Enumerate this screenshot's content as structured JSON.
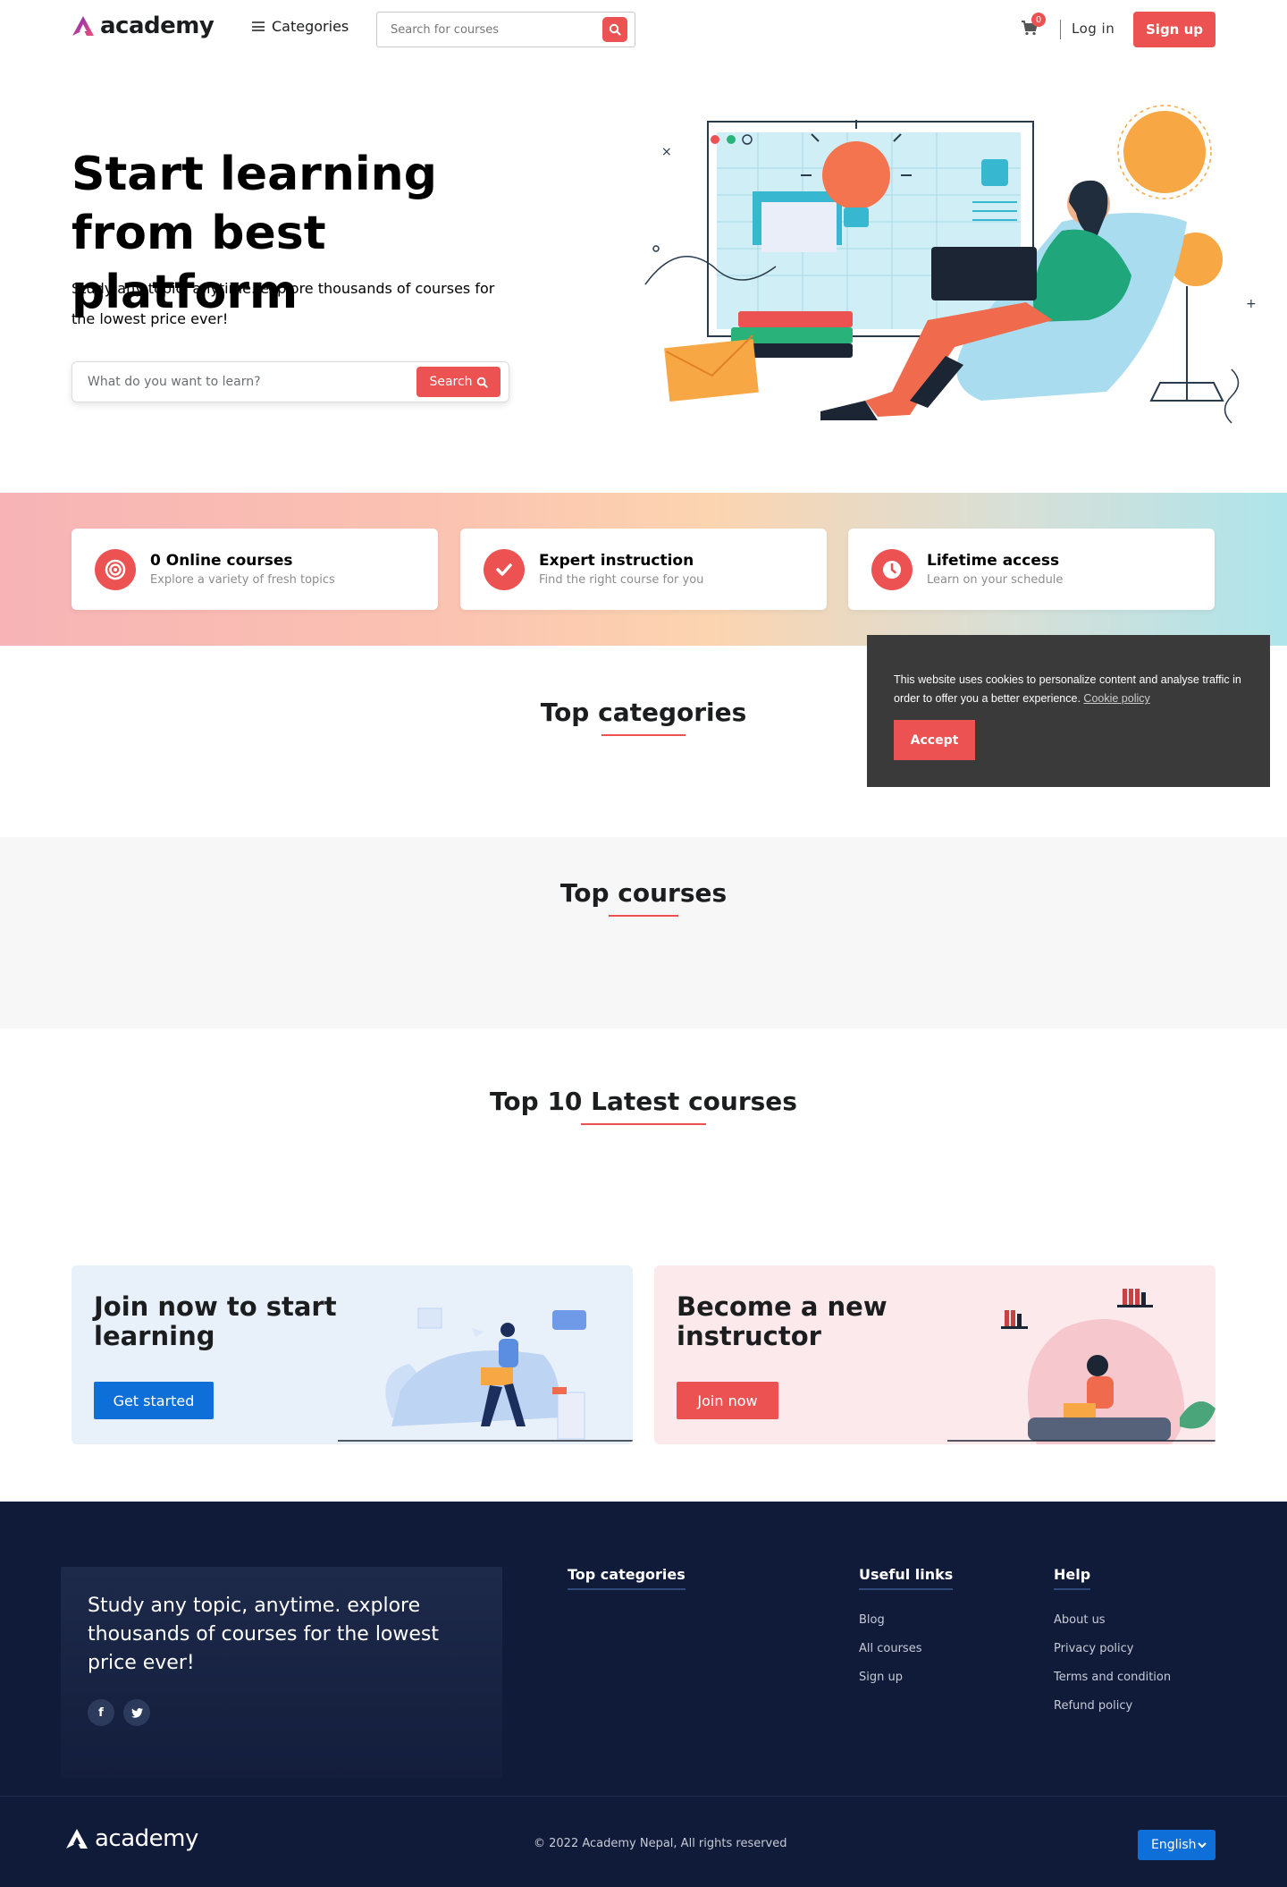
{
  "header": {
    "logo_text": "academy",
    "categories_label": "Categories",
    "search_placeholder": "Search for courses",
    "cart_count": "0",
    "login_label": "Log in",
    "signup_label": "Sign up",
    "accent_color": "#ec5252"
  },
  "hero": {
    "title": "Start learning from best platform",
    "subtitle": "Study any topic, anytime. explore thousands of courses for the lowest price ever!",
    "search_placeholder": "What do you want to learn?",
    "search_button": "Search"
  },
  "features": [
    {
      "title": "0 Online courses",
      "subtitle": "Explore a variety of fresh topics",
      "icon": "target-icon"
    },
    {
      "title": "Expert instruction",
      "subtitle": "Find the right course for you",
      "icon": "check-icon"
    },
    {
      "title": "Lifetime access",
      "subtitle": "Learn on your schedule",
      "icon": "clock-icon"
    }
  ],
  "sections": {
    "top_categories": "Top categories",
    "top_courses": "Top courses",
    "latest_courses": "Top 10 Latest courses"
  },
  "cookie": {
    "text": "This website uses cookies to personalize content and analyse traffic in order to offer you a better experience.",
    "link": "Cookie policy",
    "accept": "Accept"
  },
  "promo": {
    "join_title": "Join now to start learning",
    "join_button": "Get started",
    "instructor_title": "Become a new instructor",
    "instructor_button": "Join now"
  },
  "footer": {
    "tagline": "Study any topic, anytime. explore thousands of courses for the lowest price ever!",
    "col_categories": "Top categories",
    "col_useful": "Useful links",
    "useful_links": [
      "Blog",
      "All courses",
      "Sign up"
    ],
    "col_help": "Help",
    "help_links": [
      "About us",
      "Privacy policy",
      "Terms and condition",
      "Refund policy"
    ],
    "logo_text": "academy",
    "copyright": "© 2022 Academy Nepal, All rights reserved",
    "language": "English",
    "footer_color": "#101b3a"
  }
}
